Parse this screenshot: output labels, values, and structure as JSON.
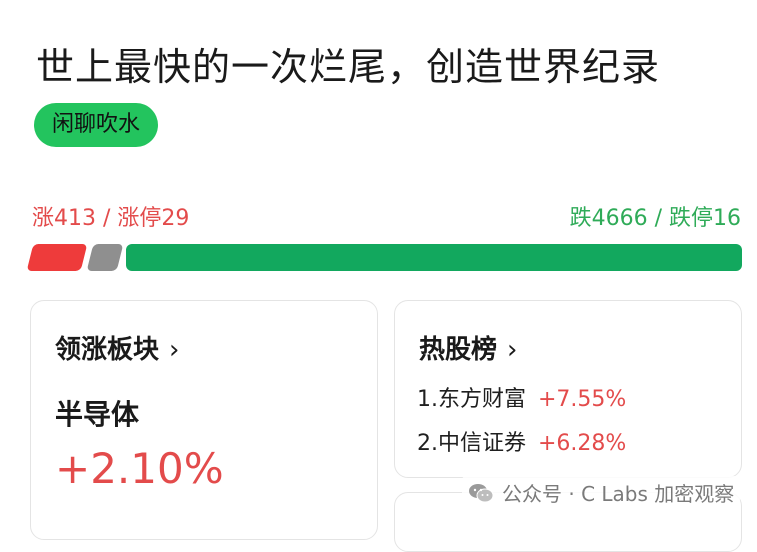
{
  "post": {
    "title": "世上最快的一次烂尾，创造世界纪录",
    "tag": "闲聊吹水"
  },
  "market": {
    "up_text": "涨413 / 涨停29",
    "down_text": "跌4666 / 跌停16",
    "colors": {
      "up": "#ee3b3b",
      "flat": "#8f8f8f",
      "down": "#12a85e"
    },
    "bar_counts": {
      "up": 413,
      "down": 4666
    }
  },
  "leading_sector": {
    "heading": "领涨板块",
    "chevron": "›",
    "name": "半导体",
    "change": "+2.10%"
  },
  "hot_stocks": {
    "heading": "热股榜",
    "chevron": "›",
    "items": [
      {
        "name": "1.东方财富",
        "change": "+7.55%"
      },
      {
        "name": "2.中信证券",
        "change": "+6.28%"
      }
    ]
  },
  "watermark": {
    "icon": "wechat-icon",
    "text": "公众号 · C Labs 加密观察"
  }
}
